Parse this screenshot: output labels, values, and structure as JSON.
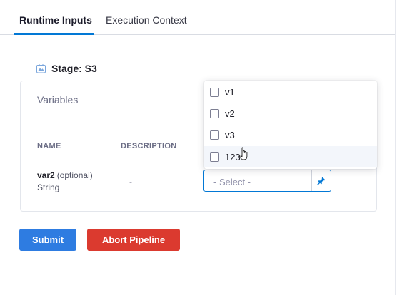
{
  "tabs": [
    {
      "label": "Runtime Inputs",
      "active": true
    },
    {
      "label": "Execution Context",
      "active": false
    }
  ],
  "stage": {
    "label": "Stage: S3",
    "icon": "stage-icon"
  },
  "variables": {
    "title": "Variables",
    "columns": {
      "name": "NAME",
      "description": "DESCRIPTION"
    },
    "rows": [
      {
        "name": "var2",
        "optional": "(optional)",
        "type": "String",
        "description": "-"
      }
    ]
  },
  "select": {
    "placeholder": "- Select -",
    "pin_icon": "pin-icon"
  },
  "dropdown": {
    "options": [
      {
        "label": "v1",
        "checked": false
      },
      {
        "label": "v2",
        "checked": false
      },
      {
        "label": "v3",
        "checked": false
      },
      {
        "label": "123",
        "checked": false,
        "hovered": true
      }
    ]
  },
  "actions": {
    "submit": "Submit",
    "abort": "Abort Pipeline"
  },
  "colors": {
    "accent": "#0278d5",
    "submit": "#2e7ce1",
    "abort": "#db3a2f"
  }
}
